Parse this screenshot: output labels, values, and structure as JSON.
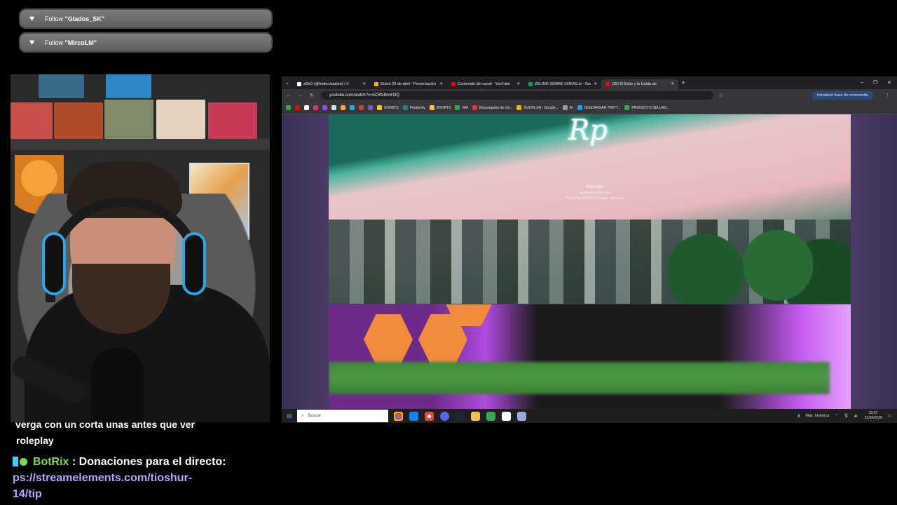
{
  "alerts": [
    {
      "prefix": "Follow ",
      "name": "\"Glados_SK\""
    },
    {
      "prefix": "Follow ",
      "name": "\"MircoLM\""
    }
  ],
  "chat": {
    "line1": "verga con un corta unas antes que ver",
    "line2": "roleplay",
    "user": "BotRix",
    "message": " : Donaciones para el directo:",
    "link1": "ps://streamelements.com/tioshur-",
    "link2": "14/tip"
  },
  "browser": {
    "tabs": [
      {
        "label": "zEkO (@fedecristalino) / X",
        "color": "#ffffff"
      },
      {
        "label": "Guion 20 de abril - Presentación",
        "color": "#f4b400"
      },
      {
        "label": "Contenido del canal - YouTube",
        "color": "#ff0000"
      },
      {
        "label": "ZELING SOBRE XOKAS.ts - Goo",
        "color": "#0f9d58"
      },
      {
        "label": "(39) El Éxito y la Caída de",
        "color": "#ff0000",
        "active": true
      }
    ],
    "url": "youtube.com/watch?v=kCRfc8nnH3Q",
    "password_hint": "Introducir frase de contraseña",
    "bookmarks": [
      {
        "label": "SHORTS",
        "color": "#ffcc00"
      },
      {
        "label": "Perplexity",
        "color": "#20808d"
      },
      {
        "label": "SHORTS",
        "color": "#ffcc00"
      },
      {
        "label": "GM",
        "color": "#34a853"
      },
      {
        "label": "Descargador de víd...",
        "color": "#e53935"
      },
      {
        "label": "GUION SN - Google...",
        "color": "#f4b400"
      },
      {
        "label": "AI",
        "color": "#999999"
      },
      {
        "label": "DESCARGAR TWITT...",
        "color": "#1da1f2"
      },
      {
        "label": "PRODUCTO SELLAD...",
        "color": "#34a853"
      }
    ]
  },
  "video": {
    "logo": "Rp",
    "discord_title": "DISCORD",
    "discord_link": "tpsairepestdiscord",
    "discord_hint": "Presiona ESPACIO para silenciar"
  },
  "taskbar": {
    "search_placeholder": "Buscar",
    "tray_label": "Máx. histórica",
    "time": "23:57",
    "date": "21/04/2026"
  },
  "colors": {
    "accent_green": "#7ed957",
    "link_purple": "#b7a6ff",
    "alert_bg": "#6f6f6f"
  }
}
